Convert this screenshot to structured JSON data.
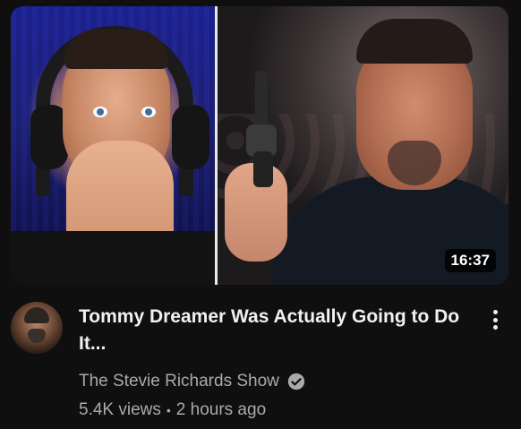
{
  "video": {
    "duration": "16:37",
    "title": "Tommy Dreamer Was Actually Going to Do It...",
    "channel": "The Stevie Richards Show",
    "views": "5.4K views",
    "separator": "•",
    "age": "2 hours ago"
  },
  "icons": {
    "verified": "check-circle-icon",
    "menu": "more-vert-icon"
  },
  "colors": {
    "background": "#0f0f0f",
    "title": "#f1f1f1",
    "secondary": "#aaaaaa"
  }
}
